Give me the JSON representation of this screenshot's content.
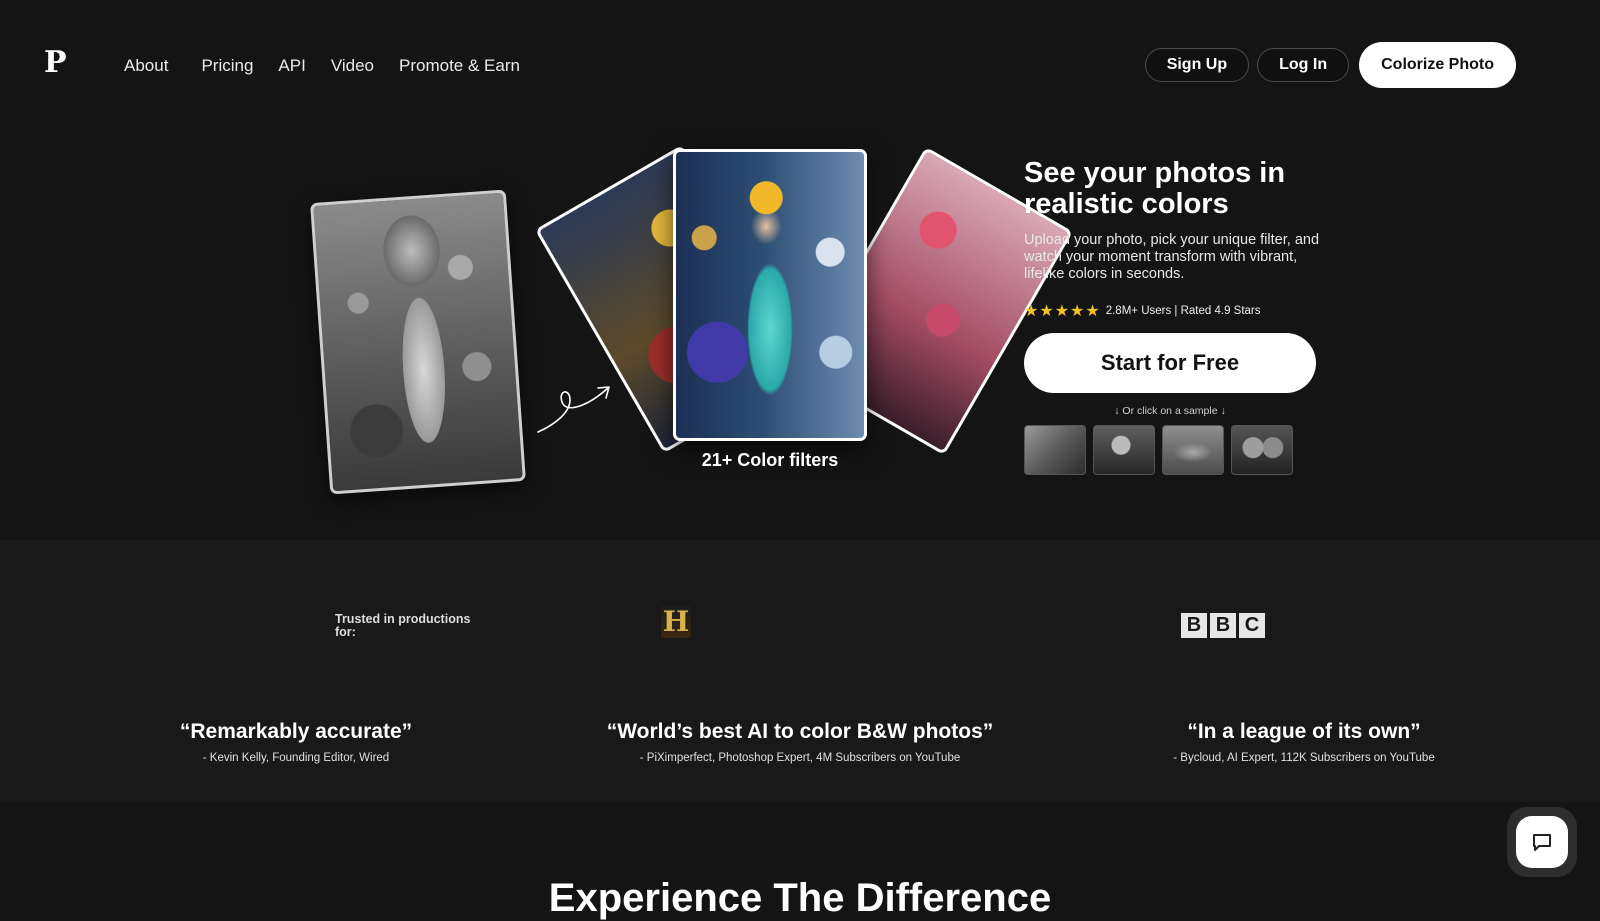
{
  "nav": {
    "logo": "P",
    "links": [
      "About",
      "Pricing",
      "API",
      "Video",
      "Promote & Earn"
    ],
    "signup_label": "Sign Up",
    "login_label": "Log In",
    "colorize_label": "Colorize Photo"
  },
  "hero": {
    "title": "See your photos in realistic colors",
    "subtitle": "Upload your photo, pick your unique filter, and watch your moment transform with vibrant, lifelike colors in seconds.",
    "stars": "★★★★★",
    "rating_text": "2.8M+ Users | Rated 4.9 Stars",
    "start_label": "Start for Free",
    "sample_label": "↓ Or click on a sample ↓",
    "filters_label": "21+ Color filters"
  },
  "trust": {
    "label": "Trusted in productions for:",
    "history_logo": "H",
    "bbc_letters": [
      "B",
      "B",
      "C"
    ]
  },
  "quotes": [
    {
      "text": "“Remarkably accurate”",
      "author": "- Kevin Kelly, Founding Editor, Wired"
    },
    {
      "text": "“World’s best AI to color B&W photos”",
      "author": "- PiXimperfect, Photoshop Expert, 4M Subscribers on YouTube"
    },
    {
      "text": "“In a league of its own”",
      "author": "- Bycloud, AI Expert, 112K Subscribers on YouTube"
    }
  ],
  "bottom": {
    "title": "Experience The Difference"
  },
  "colors": {
    "background": "#141414",
    "band": "#191919",
    "star": "#f2c12e",
    "button_bg": "#ffffff"
  },
  "icons": {
    "arrow": "curly-arrow-icon",
    "chat": "chat-bubble-icon"
  }
}
